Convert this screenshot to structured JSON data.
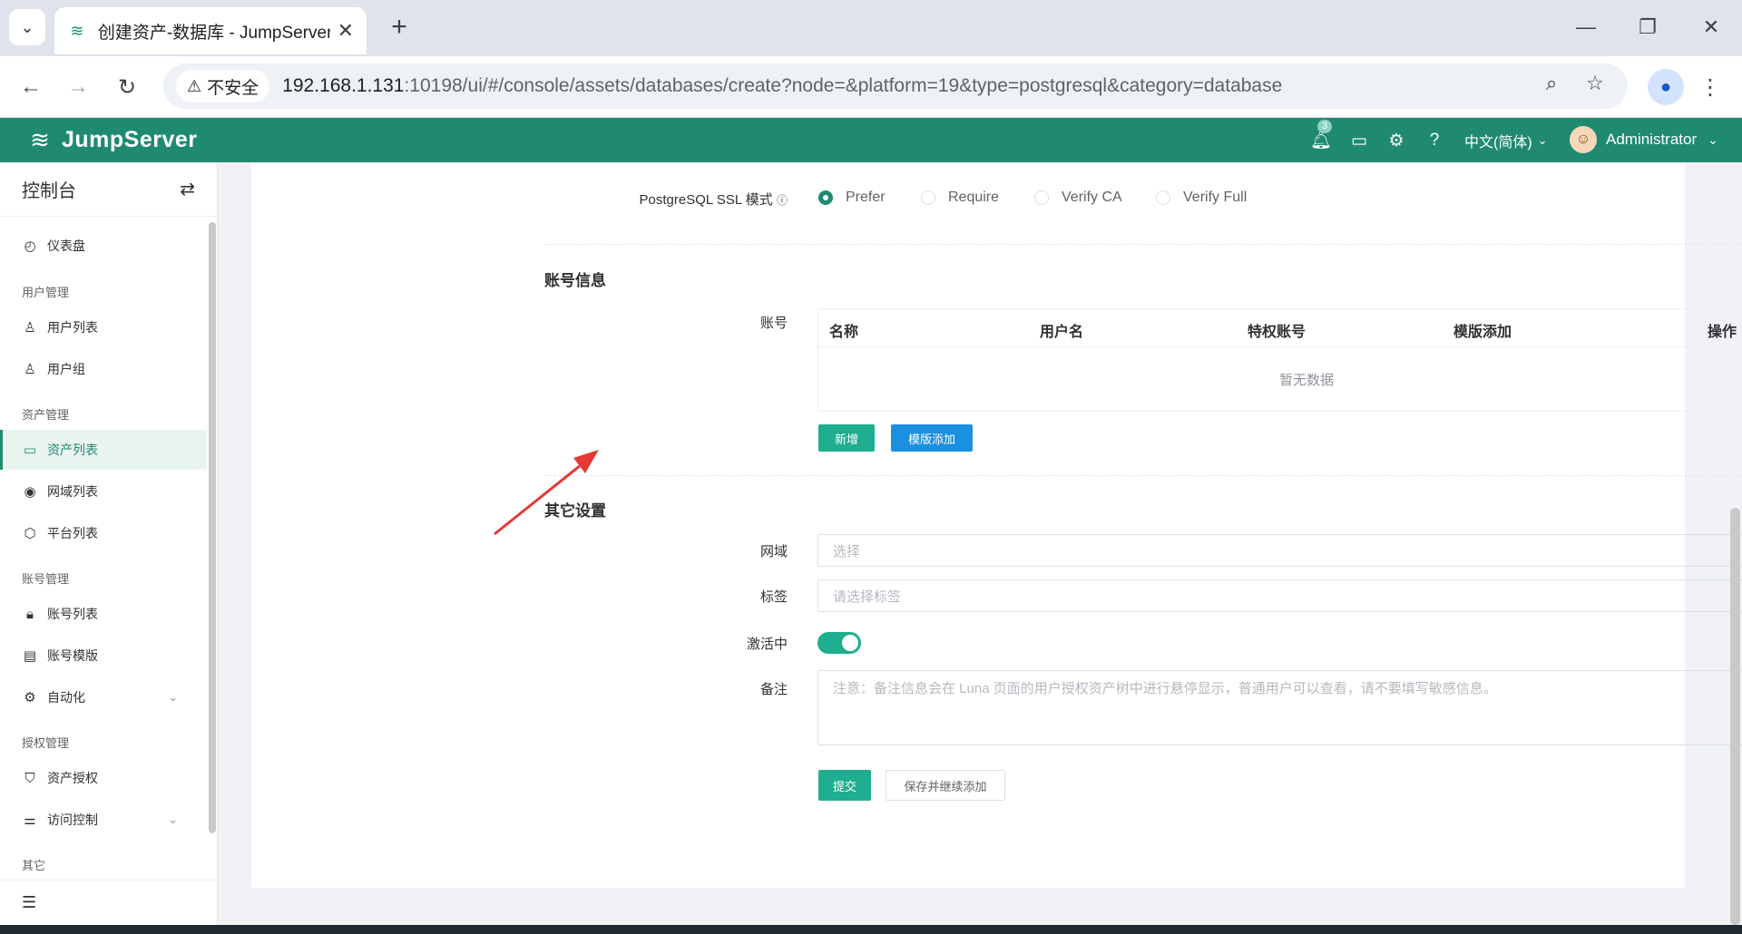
{
  "browser": {
    "tab_title": "创建资产-数据库 - JumpServer",
    "insecure_label": "不安全",
    "url_host": "192.168.1.131",
    "url_rest": ":10198/ui/#/console/assets/databases/create?node=&platform=19&type=postgresql&category=database"
  },
  "header": {
    "logo_text": "JumpServer",
    "notification_count": "3",
    "language": "中文(简体)",
    "username": "Administrator"
  },
  "sidebar": {
    "title": "控制台",
    "groups": {
      "user_mgmt": "用户管理",
      "asset_mgmt": "资产管理",
      "account_mgmt": "账号管理",
      "perm_mgmt": "授权管理",
      "other": "其它"
    },
    "items": {
      "dashboard": "仪表盘",
      "user_list": "用户列表",
      "user_group": "用户组",
      "asset_list": "资产列表",
      "domain_list": "网域列表",
      "platform_list": "平台列表",
      "account_list": "账号列表",
      "account_template": "账号模版",
      "automation": "自动化",
      "asset_permission": "资产授权",
      "access_control": "访问控制"
    }
  },
  "form": {
    "ssl_mode_label": "PostgreSQL SSL 模式",
    "ssl_options": [
      "Prefer",
      "Require",
      "Verify CA",
      "Verify Full"
    ],
    "ssl_selected": "Prefer",
    "account_section": "账号信息",
    "account_label": "账号",
    "account_table": {
      "columns": [
        "名称",
        "用户名",
        "特权账号",
        "模版添加",
        "操作"
      ],
      "empty_text": "暂无数据"
    },
    "add_button": "新增",
    "template_add_button": "模版添加",
    "other_section": "其它设置",
    "domain_label": "网域",
    "domain_placeholder": "选择",
    "labels_label": "标签",
    "labels_placeholder": "请选择标签",
    "active_label": "激活中",
    "active_value": true,
    "comment_label": "备注",
    "comment_placeholder": "注意：备注信息会在 Luna 页面的用户授权资产树中进行悬停显示，普通用户可以查看，请不要填写敏感信息。",
    "submit_button": "提交",
    "save_continue_button": "保存并继续添加"
  },
  "colors": {
    "brand": "#1f8a70",
    "primary_button": "#1fae8f",
    "info_button": "#1b8fe0",
    "annotation_arrow": "#e53935"
  }
}
